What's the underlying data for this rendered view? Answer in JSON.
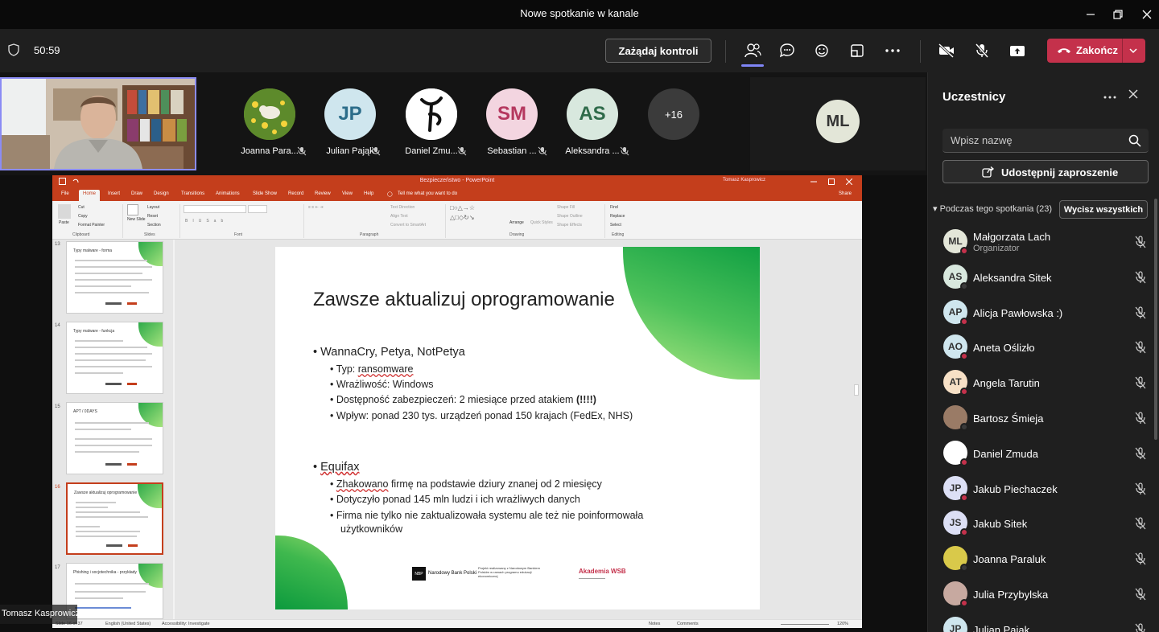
{
  "window": {
    "title": "Nowe spotkanie w kanale"
  },
  "toolbar": {
    "timer": "50:59",
    "request_control": "Zażądaj kontroli",
    "end_label": "Zakończ"
  },
  "strip": {
    "self_name": "Tomasz Kasprowicz",
    "tiles": [
      {
        "initials": "",
        "name": "Joanna Para...",
        "color": "#d9c94a"
      },
      {
        "initials": "JP",
        "name": "Julian Pająk",
        "color": "#cfe6ee"
      },
      {
        "initials": "",
        "name": "Daniel Zmu...",
        "color": "#ffffff"
      },
      {
        "initials": "SM",
        "name": "Sebastian ...",
        "color": "#f3d5e0"
      },
      {
        "initials": "AS",
        "name": "Aleksandra ...",
        "color": "#d8e8de"
      }
    ],
    "more_count": "+16",
    "ml_initials": "ML"
  },
  "ppt": {
    "title": "Bezpieczeństwo - PowerPoint",
    "user": "Tomasz Kasprowicz",
    "tabs": [
      "File",
      "Home",
      "Insert",
      "Draw",
      "Design",
      "Transitions",
      "Animations",
      "Slide Show",
      "Record",
      "Review",
      "View",
      "Help"
    ],
    "tell_me": "Tell me what you want to do",
    "share": "Share",
    "ribbon": {
      "paste": "Paste",
      "cut": "Cut",
      "copy": "Copy",
      "format_painter": "Format Painter",
      "clipboard": "Clipboard",
      "new_slide": "New Slide",
      "layout": "Layout",
      "reset": "Reset",
      "section": "Section",
      "slides": "Slides",
      "font": "Font",
      "text_direction": "Text Direction",
      "align_text": "Align Text",
      "convert_smartart": "Convert to SmartArt",
      "paragraph": "Paragraph",
      "arrange": "Arrange",
      "quick_styles": "Quick Styles",
      "shape_fill": "Shape Fill",
      "shape_outline": "Shape Outline",
      "shape_effects": "Shape Effects",
      "drawing": "Drawing",
      "find": "Find",
      "replace": "Replace",
      "select": "Select",
      "editing": "Editing"
    },
    "thumbs": [
      {
        "num": "13",
        "title": "Typy malware - forma"
      },
      {
        "num": "14",
        "title": "Typy malware - funkcja"
      },
      {
        "num": "15",
        "title": "APT / 0DAYS"
      },
      {
        "num": "16",
        "title": "Zawsze aktualizuj oprogramowanie"
      },
      {
        "num": "17",
        "title": "Phishing i socjotechnika - przykłady"
      }
    ],
    "status": {
      "slide": "Slide 16 of 37",
      "lang": "English (United States)",
      "access": "Accessibility: Investigate",
      "notes": "Notes",
      "comments": "Comments",
      "zoom": "120%"
    }
  },
  "slide": {
    "title": "Zawsze aktualizuj oprogramowanie",
    "b1": "WannaCry, Petya, NotPetya",
    "b1_1_pre": "Typ: ",
    "b1_1_ul": "ransomware",
    "b1_2": "Wrażliwość: Windows",
    "b1_3": "Dostępność zabezpieczeń: 2 miesiące przed atakiem",
    "b1_3_bold": "(!!!!)",
    "b1_4": "Wpływ: ponad 230 tys. urządzeń ponad 150 krajach (FedEx, NHS)",
    "b2": "Equifax",
    "b2_1_ul": "Zhakowano",
    "b2_1_post": " firmę na podstawie dziury znanej od 2 miesięcy",
    "b2_2": "Dotyczyło ponad 145 mln ludzi i ich wrażliwych danych",
    "b2_3a": "Firma nie tylko nie zaktualizowała systemu ale też nie poinformowała",
    "b2_3b": "użytkowników",
    "nbp_box": "NBP",
    "nbp_name": "Narodowy Bank Polski",
    "nbp_project": "Projekt realizowany z Narodowym Bankiem Polskim w ramach programu edukacji ekonomicznej",
    "wsb": "Akademia WSB"
  },
  "panel": {
    "title": "Uczestnicy",
    "search_placeholder": "Wpisz nazwę",
    "invite": "Udostępnij zaproszenie",
    "section": "Podczas tego spotkania (23)",
    "mute_all": "Wycisz wszystkich",
    "people": [
      {
        "initials": "ML",
        "name": "Małgorzata Lach",
        "role": "Organizator",
        "color": "#e3e6d8",
        "status": "busy"
      },
      {
        "initials": "AS",
        "name": "Aleksandra Sitek",
        "role": "",
        "color": "#d8e8de",
        "status": "away"
      },
      {
        "initials": "AP",
        "name": "Alicja Pawłowska :)",
        "role": "",
        "color": "#cfe6ee",
        "status": "busy"
      },
      {
        "initials": "AO",
        "name": "Aneta Oślizło",
        "role": "",
        "color": "#cfe6ee",
        "status": "busy"
      },
      {
        "initials": "AT",
        "name": "Angela Tarutin",
        "role": "",
        "color": "#f7e0c6",
        "status": "busy"
      },
      {
        "initials": "",
        "name": "Bartosz Śmieja",
        "role": "",
        "color": "#9a7b66",
        "status": "away"
      },
      {
        "initials": "",
        "name": "Daniel Zmuda",
        "role": "",
        "color": "#ffffff",
        "status": "busy"
      },
      {
        "initials": "JP",
        "name": "Jakub Piechaczek",
        "role": "",
        "color": "#dcdff5",
        "status": "busy"
      },
      {
        "initials": "JS",
        "name": "Jakub Sitek",
        "role": "",
        "color": "#dcdff5",
        "status": "busy"
      },
      {
        "initials": "",
        "name": "Joanna Paraluk",
        "role": "",
        "color": "#d9c94a",
        "status": "away"
      },
      {
        "initials": "",
        "name": "Julia Przybylska",
        "role": "",
        "color": "#c7a9a0",
        "status": "busy"
      },
      {
        "initials": "JP",
        "name": "Julian Pająk",
        "role": "",
        "color": "#cfe6ee",
        "status": "busy"
      }
    ]
  }
}
